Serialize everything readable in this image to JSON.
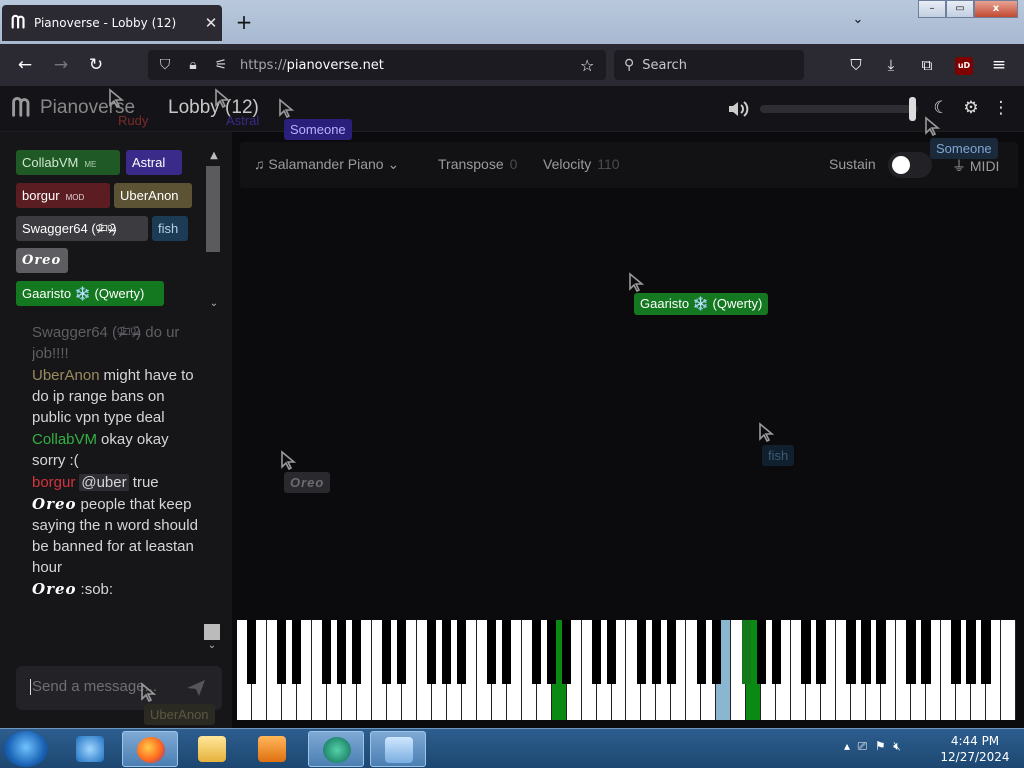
{
  "browser": {
    "tab_title": "Pianoverse - Lobby (12)",
    "close_glyph": "✕",
    "new_tab_glyph": "+",
    "tab_menu_glyph": "⌄",
    "url_proto": "https://",
    "url_host": "pianoverse.net",
    "search_placeholder": "Search",
    "ublock_label": "uD",
    "window_controls": [
      "–",
      "▭",
      "x"
    ]
  },
  "app": {
    "brand": "Pianoverse",
    "room_title": "Lobby (12)",
    "volume_level": 0.98,
    "header_icons": [
      "volume-icon",
      "moon-icon",
      "gear-icon",
      "more-icon"
    ]
  },
  "users": [
    {
      "name": "CollabVM",
      "badge": "ME",
      "color": "#1f5a26",
      "text": "#cfe8cf"
    },
    {
      "name": "Astral",
      "badge": "",
      "color": "#3a2a8a",
      "text": "#ffffff"
    },
    {
      "name": "borgur",
      "badge": "MOD",
      "color": "#5c1d22",
      "text": "#ffffff"
    },
    {
      "name": "UberAnon",
      "badge": "",
      "color": "#5c5234",
      "text": "#ffffff"
    },
    {
      "name": "Swagger64 (ᵒ̴̶̷᷄⌑ᵒ̴̶̷᷅)",
      "badge": "",
      "color": "#3b3b40",
      "text": "#ffffff"
    },
    {
      "name": "fish",
      "badge": "",
      "color": "#1c3b55",
      "text": "#b6d2e6"
    },
    {
      "name": "Oreo",
      "badge": "",
      "color": "#5e5e62",
      "text": "#ffffff"
    },
    {
      "name": "Gaaristo ❄️ (Qwerty)",
      "badge": "",
      "color": "#13781f",
      "text": "#ffffff"
    }
  ],
  "overlay_names": {
    "someone_sidebar": "Someone"
  },
  "chat": {
    "faded_line": "Swagger64 (ᵒ̴̶̷᷄⌑ᵒ̴̶̷᷅) do ur job!!!!",
    "messages": [
      {
        "nick": "UberAnon",
        "nick_color": "#9a8a5f",
        "text": "might have to do ip range bans on public vpn type deal"
      },
      {
        "nick": "CollabVM",
        "nick_color": "#33b044",
        "text": "okay okay sorry :("
      },
      {
        "nick": "borgur",
        "nick_color": "#d4323d",
        "mention": "@uber",
        "text": "true"
      },
      {
        "nick": "Oreo",
        "nick_color": "#ffffff",
        "text": "people that keep saying the n word should be banned for at leastan hour"
      },
      {
        "nick": "Oreo",
        "nick_color": "#ffffff",
        "text": ":sob:"
      }
    ],
    "input_placeholder": "Send a message..."
  },
  "toolbar": {
    "instrument": "Salamander Piano",
    "transpose_label": "Transpose",
    "transpose_value": "0",
    "velocity_label": "Velocity",
    "velocity_value": "110",
    "sustain_label": "Sustain",
    "sustain_on": false,
    "midi_label": "MIDI"
  },
  "cursors": [
    {
      "name": "Rudy",
      "bg": "transparent",
      "color": "#7a2a2a"
    },
    {
      "name": "Astral",
      "bg": "transparent",
      "color": "#3a2a8a"
    },
    {
      "name": "Someone",
      "bg": "#2a1f7a",
      "color": "#b8b0ff"
    },
    {
      "name": "Someone",
      "bg": "#1b2a3a",
      "color": "#7fa7d6"
    },
    {
      "name": "Gaaristo ❄️ (Qwerty)",
      "bg": "#13781f",
      "color": "#ffffff"
    },
    {
      "name": "fish",
      "bg": "#10202e",
      "color": "#3b5b73"
    },
    {
      "name": "Oreo",
      "bg": "#2a2a2e",
      "color": "#6b6b70"
    },
    {
      "name": "UberAnon",
      "bg": "#2b2a22",
      "color": "#5c5743"
    }
  ],
  "piano": {
    "white_key_count": 52,
    "highlighted_white": [
      {
        "index": 21,
        "color": "green"
      },
      {
        "index": 32,
        "color": "blue"
      },
      {
        "index": 34,
        "color": "green"
      }
    ]
  },
  "taskbar": {
    "apps": [
      "ie-icon",
      "firefox-icon",
      "explorer-icon",
      "media-player-icon",
      "collabvm-icon",
      "paint-icon"
    ],
    "time": "4:44 PM",
    "date": "12/27/2024"
  }
}
